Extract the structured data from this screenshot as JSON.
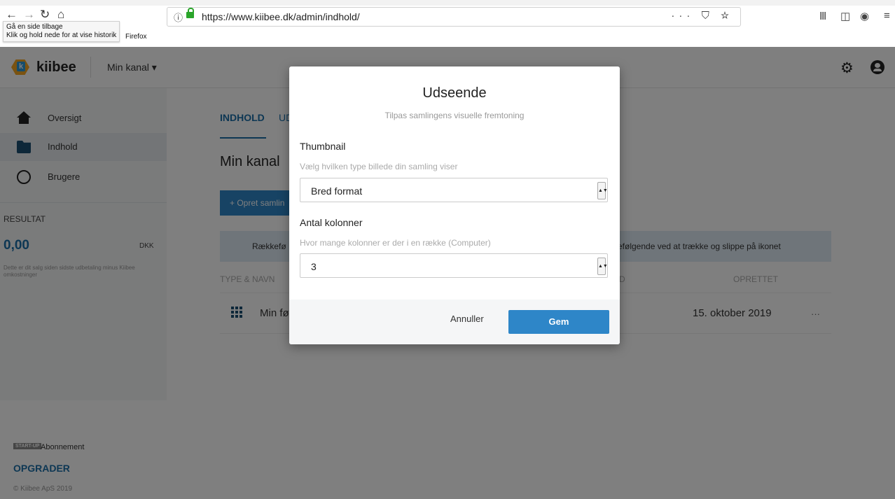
{
  "browser": {
    "url": "https://www.kiibee.dk/admin/indhold/",
    "tooltip_line1": "Gå en side tilbage",
    "tooltip_line2": "Klik og hold nede for at vise historik",
    "tooltip_tail": "Firefox",
    "url_actions": "··· ⛉ ☆",
    "icons": [
      "back-icon",
      "forward-icon",
      "reload-icon",
      "home-icon",
      "info-icon",
      "lock-icon",
      "library-icon",
      "sidebar-icon",
      "extension-icon",
      "menu-icon"
    ]
  },
  "header": {
    "logo_letter": "k",
    "logo_text": "kiibee",
    "channel": "Min kanal ▾"
  },
  "sidebar": {
    "items": [
      {
        "label": "Oversigt",
        "icon": "home-icon"
      },
      {
        "label": "Indhold",
        "icon": "folder-icon",
        "active": true
      },
      {
        "label": "Brugere",
        "icon": "users-icon"
      }
    ],
    "result_label": "RESULTAT",
    "result_value": "0,00",
    "result_currency": "DKK",
    "result_note": "Dette er dit salg siden sidste udbetaling minus Kiibee omkostninger",
    "plan_badge": "START-UP",
    "plan_label": "Abonnement",
    "upgrade": "OPGRADER",
    "copyright": "© Kiibee ApS 2019"
  },
  "main": {
    "tab_active": "INDHOLD",
    "tab_other": "UD",
    "title": "Min kanal",
    "create_button": "+ Opret samlin",
    "info_left": "Rækkefø",
    "info_right": "efølgende ved at trække og slippe på ikonet",
    "columns": [
      "TYPE & NAVN",
      "D",
      "OPRETTET"
    ],
    "rows": [
      {
        "name": "Min fø",
        "created": "15. oktober 2019",
        "more": "···"
      }
    ]
  },
  "modal": {
    "title": "Udseende",
    "subtitle": "Tilpas samlingens visuelle fremtoning",
    "thumbnail_label": "Thumbnail",
    "thumbnail_help": "Vælg hvilken type billede din samling viser",
    "thumbnail_value": "Bred format",
    "columns_label": "Antal kolonner",
    "columns_help": "Hvor mange kolonner er der i en række (Computer)",
    "columns_value": "3",
    "cancel": "Annuller",
    "save": "Gem"
  },
  "colors": {
    "accent": "#2e86c8",
    "link": "#1b6fa8",
    "overlay": "rgba(0,0,0,0.5)"
  }
}
